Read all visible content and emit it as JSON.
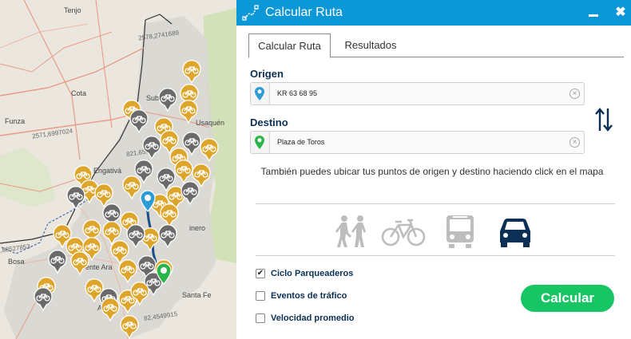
{
  "window": {
    "title": "Calcular Ruta",
    "close_glyph": "✖"
  },
  "tabs": [
    {
      "label": "Calcular Ruta"
    },
    {
      "label": "Resultados"
    }
  ],
  "origin": {
    "label": "Origen",
    "value": "KR 63 68 95"
  },
  "destination": {
    "label": "Destino",
    "value": "Plaza de Toros"
  },
  "hint": "También puedes ubicar tus puntos de origen y destino haciendo click en el mapa",
  "modes": [
    {
      "name": "walk",
      "icon": "walk-icon",
      "selected": false
    },
    {
      "name": "bike",
      "icon": "bicycle-icon",
      "selected": false
    },
    {
      "name": "bus",
      "icon": "bus-icon",
      "selected": false
    },
    {
      "name": "car",
      "icon": "car-icon",
      "selected": true
    }
  ],
  "options": [
    {
      "label": "Ciclo Parqueaderos",
      "checked": true
    },
    {
      "label": "Eventos de tráfico",
      "checked": false
    },
    {
      "label": "Velocidad promedio",
      "checked": false
    }
  ],
  "calculate_label": "Calcular",
  "map": {
    "labels": {
      "tenjo": "Tenjo",
      "cota": "Cota",
      "funza": "Funza",
      "suba": "Sub",
      "usaquen": "Usaquén",
      "engativa": "Engativá",
      "chapinero": "inero",
      "bosa": "Bosa",
      "kennedy": "ente Ara",
      "santa_fe": "Santa Fe",
      "antonio": "Anto",
      "coord_1": "2578,2741689",
      "coord_2": "2571,6997024",
      "coord_3": "821,653",
      "coord_4": ",88527853",
      "coord_5": "82,4549915"
    }
  },
  "colors": {
    "titlebar": "#0c97d7",
    "label_navy": "#0b2f55",
    "calc_green": "#18c564",
    "pin_orange": "#dea52b",
    "pin_gray": "#6a6a6a",
    "origin_pin": "#2d9bd6",
    "destination_pin": "#2bb54a"
  }
}
